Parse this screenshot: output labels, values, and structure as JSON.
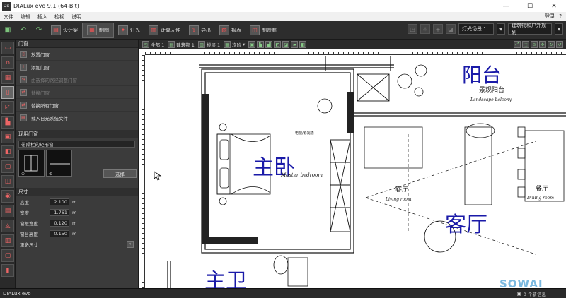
{
  "window": {
    "app_icon": "Dx",
    "title": "DIALux evo 9.1  (64-Bit)",
    "controls": [
      "—",
      "☐",
      "✕"
    ]
  },
  "menu": {
    "items": [
      "文件",
      "编辑",
      "插入",
      "检视",
      "说明"
    ],
    "login": "登录",
    "help": "?"
  },
  "toolbar": {
    "modes": [
      "设计案",
      "制图",
      "灯光",
      "计算元件",
      "导出",
      "报表",
      "制造商"
    ],
    "light_scene": "灯光场景 1",
    "planning": "建筑物和户外规划"
  },
  "left_icons": [
    "floor-icon",
    "building-icon",
    "window-icon",
    "door-icon",
    "roof-icon",
    "stairs-icon",
    "furniture-icon",
    "surface-icon",
    "room-icon",
    "cube-icon",
    "luminaire-icon",
    "table-icon",
    "shape-icon",
    "layer-icon",
    "frame-icon",
    "column-icon"
  ],
  "panel": {
    "door_header": "门窗",
    "door_actions": [
      {
        "label": "放置门窗",
        "enabled": true
      },
      {
        "label": "添加门窗",
        "enabled": true
      },
      {
        "label": "由选择的路径调整门窗",
        "enabled": false
      },
      {
        "label": "替换门窗",
        "enabled": false
      },
      {
        "label": "替换所有门窗",
        "enabled": true
      },
      {
        "label": "载入日光系统文件",
        "enabled": true
      }
    ],
    "applied_header": "现用门窗",
    "applied_type": "带隔栏的矩形窗",
    "choose_label": "选择",
    "size_header": "尺寸",
    "dimensions": [
      {
        "label": "高度",
        "value": "2.100",
        "unit": "m"
      },
      {
        "label": "宽度",
        "value": "1.761",
        "unit": "m"
      },
      {
        "label": "窗框宽度",
        "value": "0.120",
        "unit": "m"
      },
      {
        "label": "窗台高度",
        "value": "0.150",
        "unit": "m"
      }
    ],
    "more_sizes": "更多尺寸"
  },
  "subtoolbar": {
    "scope": "全部 1",
    "building": "建筑物 1",
    "floor": "楼层 1",
    "level": "次阶"
  },
  "canvas": {
    "labels_big": [
      "阳台",
      "主卧",
      "客厅",
      "主卫"
    ],
    "labels_small": [
      "景观阳台",
      "Landscape balcony",
      "Master bedroom",
      "客厅",
      "Living room",
      "餐厅",
      "Dining room",
      "电视/影视墙"
    ]
  },
  "status": {
    "logo": "DIALux evo",
    "messages": "0 个新信息"
  },
  "watermark": "SOWAI"
}
